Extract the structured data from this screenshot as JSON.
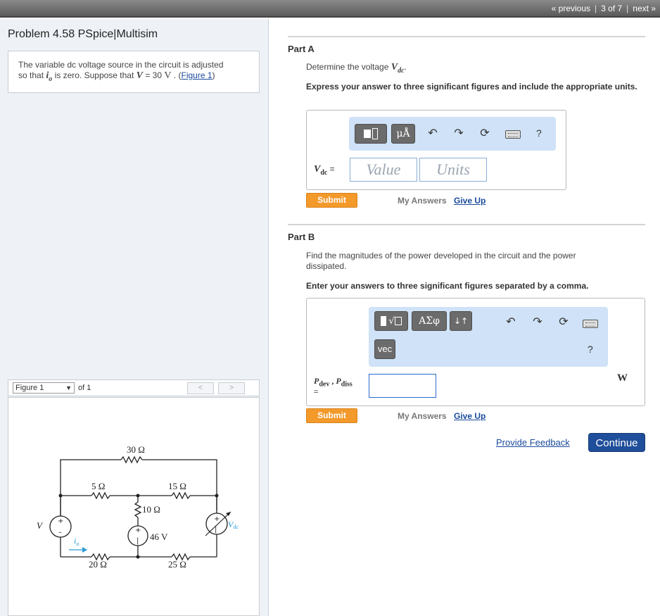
{
  "topnav": {
    "previous": "« previous",
    "position": "3 of 7",
    "next": "next »"
  },
  "problem": {
    "title": "Problem 4.58 PSpice|Multisim",
    "text1": "The variable dc voltage source in the circuit is adjusted",
    "text2a": "so that ",
    "var_io": "i",
    "var_io_sub": "o",
    "text2b": " is zero. Suppose that ",
    "var_V": "V",
    "eq": " = 30 ",
    "unit_V": "V",
    "text2c": " . (",
    "figure_link": "Figure 1",
    "text2d": ")"
  },
  "figure": {
    "select_value": "Figure 1",
    "of_label": "of 1",
    "prev": "<",
    "next": ">",
    "labels": {
      "r30": "30 Ω",
      "r5": "5 Ω",
      "r15": "15 Ω",
      "r10": "10 Ω",
      "v46": "46 V",
      "r20": "20 Ω",
      "r25": "25 Ω",
      "V": "V",
      "io": "i",
      "io_sub": "o",
      "vdc": "V",
      "vdc_sub": "dc"
    }
  },
  "partA": {
    "label": "Part A",
    "question_prefix": "Determine the voltage ",
    "question_var": "V",
    "question_var_sub": "dc",
    "question_suffix": ".",
    "instruction": "Express your answer to three significant figures and include the appropriate units.",
    "toolbar": {
      "templates_icon": "templates-icon",
      "units_btn": "μÅ",
      "help": "?"
    },
    "field_label_var": "V",
    "field_label_sub": "dc",
    "field_label_eq": " =",
    "value_placeholder": "Value",
    "units_placeholder": "Units",
    "submit": "Submit",
    "my_answers": "My Answers",
    "give_up": "Give Up"
  },
  "partB": {
    "label": "Part B",
    "question_line1": "Find the magnitudes of the power developed in the circuit and the power",
    "question_line2": "dissipated.",
    "instruction": "Enter your answers to three significant figures separated by a comma.",
    "toolbar": {
      "greek_btn": "ΑΣφ",
      "arrows_btn": "↓↑",
      "vec_btn": "vec",
      "help": "?"
    },
    "field_label_p1": "P",
    "field_label_p1_sub": "dev",
    "field_label_sep": " , ",
    "field_label_p2": "P",
    "field_label_p2_sub": "diss",
    "field_label_eq": "=",
    "value": "",
    "unit": "W",
    "submit": "Submit",
    "my_answers": "My Answers",
    "give_up": "Give Up"
  },
  "footer": {
    "feedback": "Provide Feedback",
    "continue": "Continue"
  }
}
